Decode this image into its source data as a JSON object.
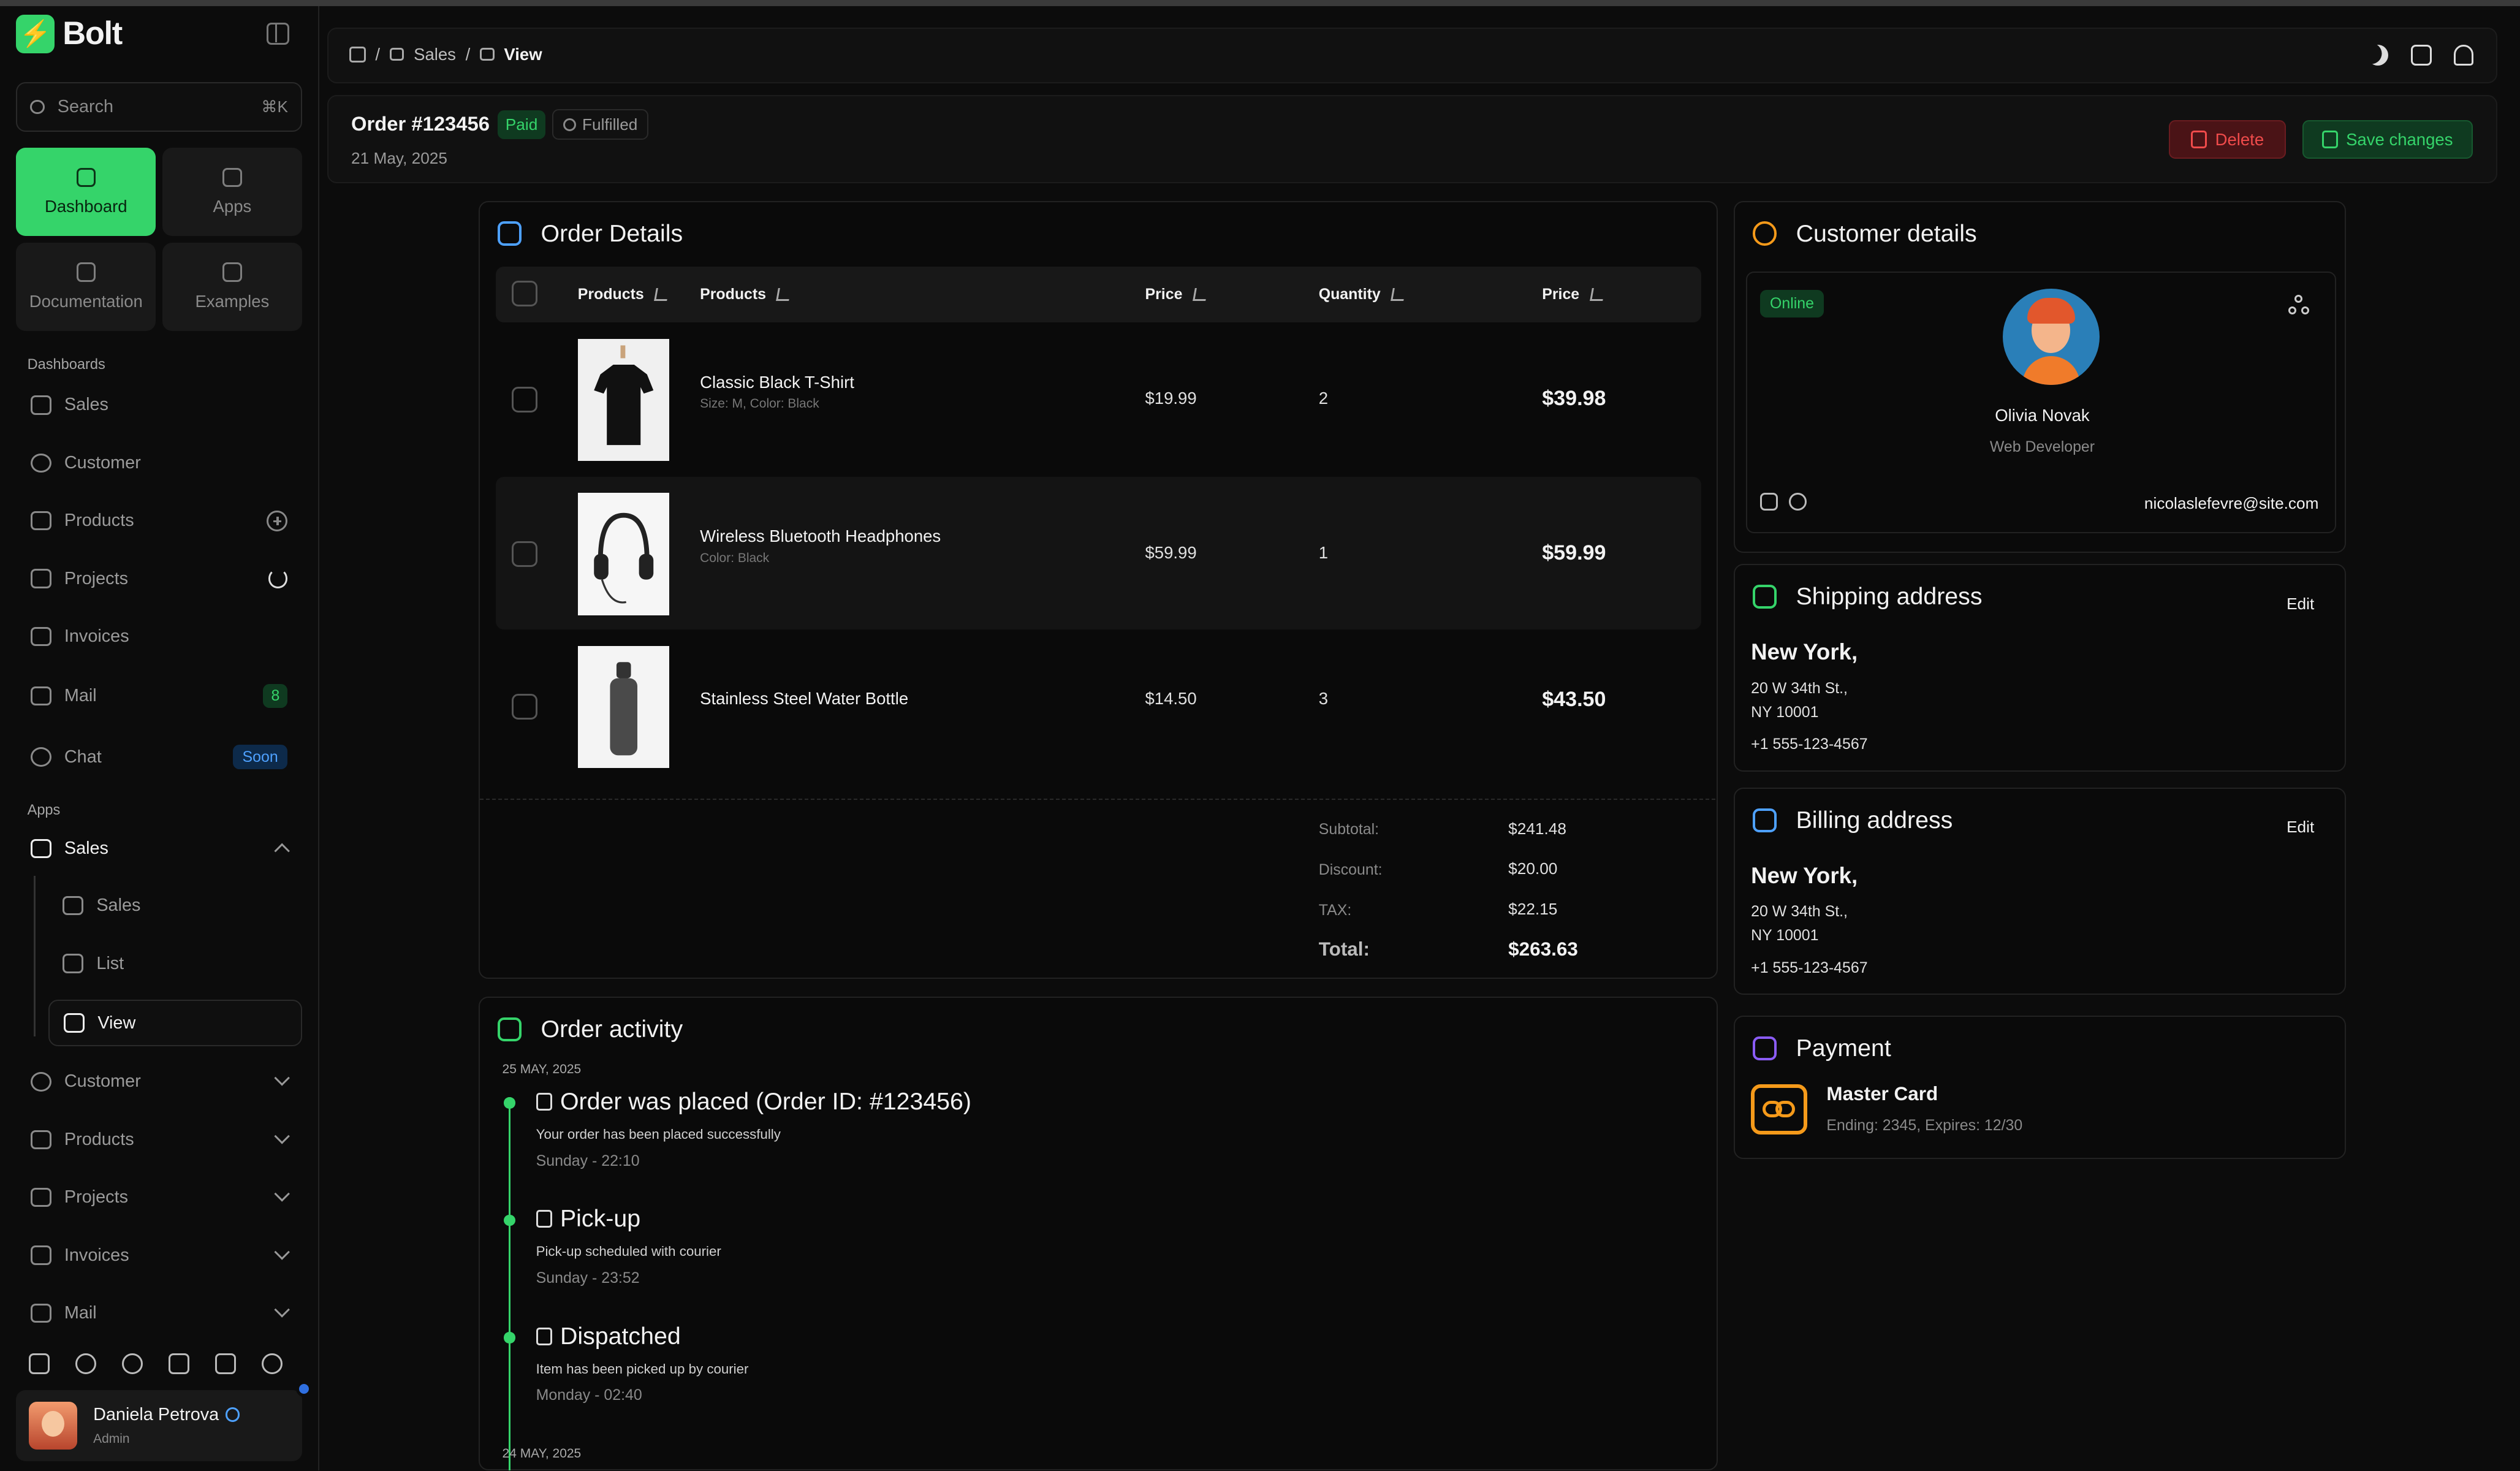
{
  "brand": {
    "name": "Bolt",
    "logo_glyph": "⚡",
    "accent": "#35d46a"
  },
  "search": {
    "placeholder": "Search",
    "shortcut": "⌘K"
  },
  "tiles": [
    {
      "label": "Dashboard",
      "icon": "home-icon"
    },
    {
      "label": "Apps",
      "icon": "grid-icon"
    },
    {
      "label": "Documentation",
      "icon": "document-icon"
    },
    {
      "label": "Examples",
      "icon": "star-icon"
    }
  ],
  "sidebar": {
    "dashboards_label": "Dashboards",
    "apps_label": "Apps",
    "dashboards": [
      {
        "label": "Sales"
      },
      {
        "label": "Customer"
      },
      {
        "label": "Products"
      },
      {
        "label": "Projects"
      },
      {
        "label": "Invoices"
      },
      {
        "label": "Mail",
        "badge": "8"
      },
      {
        "label": "Chat",
        "badge": "Soon"
      }
    ],
    "apps": [
      {
        "label": "Sales"
      },
      {
        "label": "Customer"
      },
      {
        "label": "Products"
      },
      {
        "label": "Projects"
      },
      {
        "label": "Invoices"
      },
      {
        "label": "Mail"
      }
    ],
    "sales_sub": [
      {
        "label": "Sales"
      },
      {
        "label": "List"
      },
      {
        "label": "View"
      }
    ]
  },
  "user": {
    "name": "Daniela Petrova",
    "role": "Admin"
  },
  "breadcrumb": {
    "sep": "/",
    "section": "Sales",
    "current": "View"
  },
  "order": {
    "title": "Order #123456",
    "paid": "Paid",
    "fulfilled": "Fulfilled",
    "date": "21 May, 2025",
    "delete_label": "Delete",
    "save_label": "Save changes"
  },
  "order_details": {
    "title": "Order Details",
    "headers": [
      "Products",
      "Products",
      "Price",
      "Quantity",
      "Price"
    ],
    "items": [
      {
        "name": "Classic Black T-Shirt",
        "meta": "Size: M, Color: Black",
        "price": "$19.99",
        "qty": "2",
        "total": "$39.98"
      },
      {
        "name": "Wireless Bluetooth Headphones",
        "meta": "Color: Black",
        "price": "$59.99",
        "qty": "1",
        "total": "$59.99"
      },
      {
        "name": "Stainless Steel Water Bottle",
        "meta": "",
        "price": "$14.50",
        "qty": "3",
        "total": "$43.50"
      }
    ],
    "summary": {
      "subtotal_label": "Subtotal:",
      "subtotal": "$241.48",
      "discount_label": "Discount:",
      "discount": "$20.00",
      "tax_label": "TAX:",
      "tax": "$22.15",
      "total_label": "Total:",
      "total": "$263.63"
    }
  },
  "activity": {
    "title": "Order activity",
    "date1": "25 MAY, 2025",
    "date2": "24 MAY, 2025",
    "events": [
      {
        "title": "Order was placed (Order ID: #123456)",
        "desc": "Your order has been placed successfully",
        "time": "Sunday - 22:10"
      },
      {
        "title": "Pick-up",
        "desc": "Pick-up scheduled with courier",
        "time": "Sunday - 23:52"
      },
      {
        "title": "Dispatched",
        "desc": "Item has been picked up by courier",
        "time": "Monday - 02:40"
      }
    ]
  },
  "customer": {
    "title": "Customer details",
    "status": "Online",
    "name": "Olivia Novak",
    "role": "Web Developer",
    "email": "nicolaslefevre@site.com"
  },
  "shipping": {
    "title": "Shipping address",
    "edit": "Edit",
    "city": "New York,",
    "line1": "20 W 34th St.,",
    "line2": "NY 10001",
    "phone": "+1 555-123-4567"
  },
  "billing": {
    "title": "Billing address",
    "edit": "Edit",
    "city": "New York,",
    "line1": "20 W 34th St.,",
    "line2": "NY 10001",
    "phone": "+1 555-123-4567"
  },
  "payment": {
    "title": "Payment",
    "card": "Master Card",
    "details": "Ending: 2345, Expires: 12/30"
  },
  "colors": {
    "green": "#35d46a",
    "red": "#f04b4b",
    "blue": "#4ea1ff",
    "orange": "#f59a1a",
    "purple": "#8b5cf6"
  }
}
